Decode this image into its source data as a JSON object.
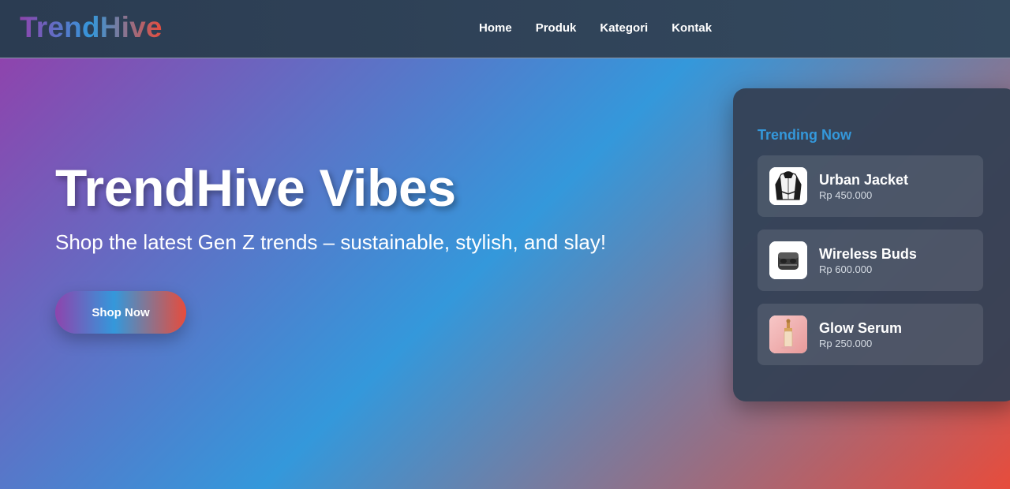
{
  "header": {
    "logo": "TrendHive",
    "nav": [
      "Home",
      "Produk",
      "Kategori",
      "Kontak"
    ]
  },
  "hero": {
    "title": "TrendHive Vibes",
    "subtitle": "Shop the latest Gen Z trends – sustainable, stylish, and slay!",
    "cta_label": "Shop Now"
  },
  "trending": {
    "title": "Trending Now",
    "items": [
      {
        "name": "Urban Jacket",
        "price": "Rp 450.000",
        "icon": "jacket-icon"
      },
      {
        "name": "Wireless Buds",
        "price": "Rp 600.000",
        "icon": "earbuds-icon"
      },
      {
        "name": "Glow Serum",
        "price": "Rp 250.000",
        "icon": "serum-bottle-icon"
      }
    ]
  },
  "colors": {
    "purple": "#8e44ad",
    "blue": "#3498db",
    "red": "#e74c3c",
    "dark": "#2c3e50"
  }
}
